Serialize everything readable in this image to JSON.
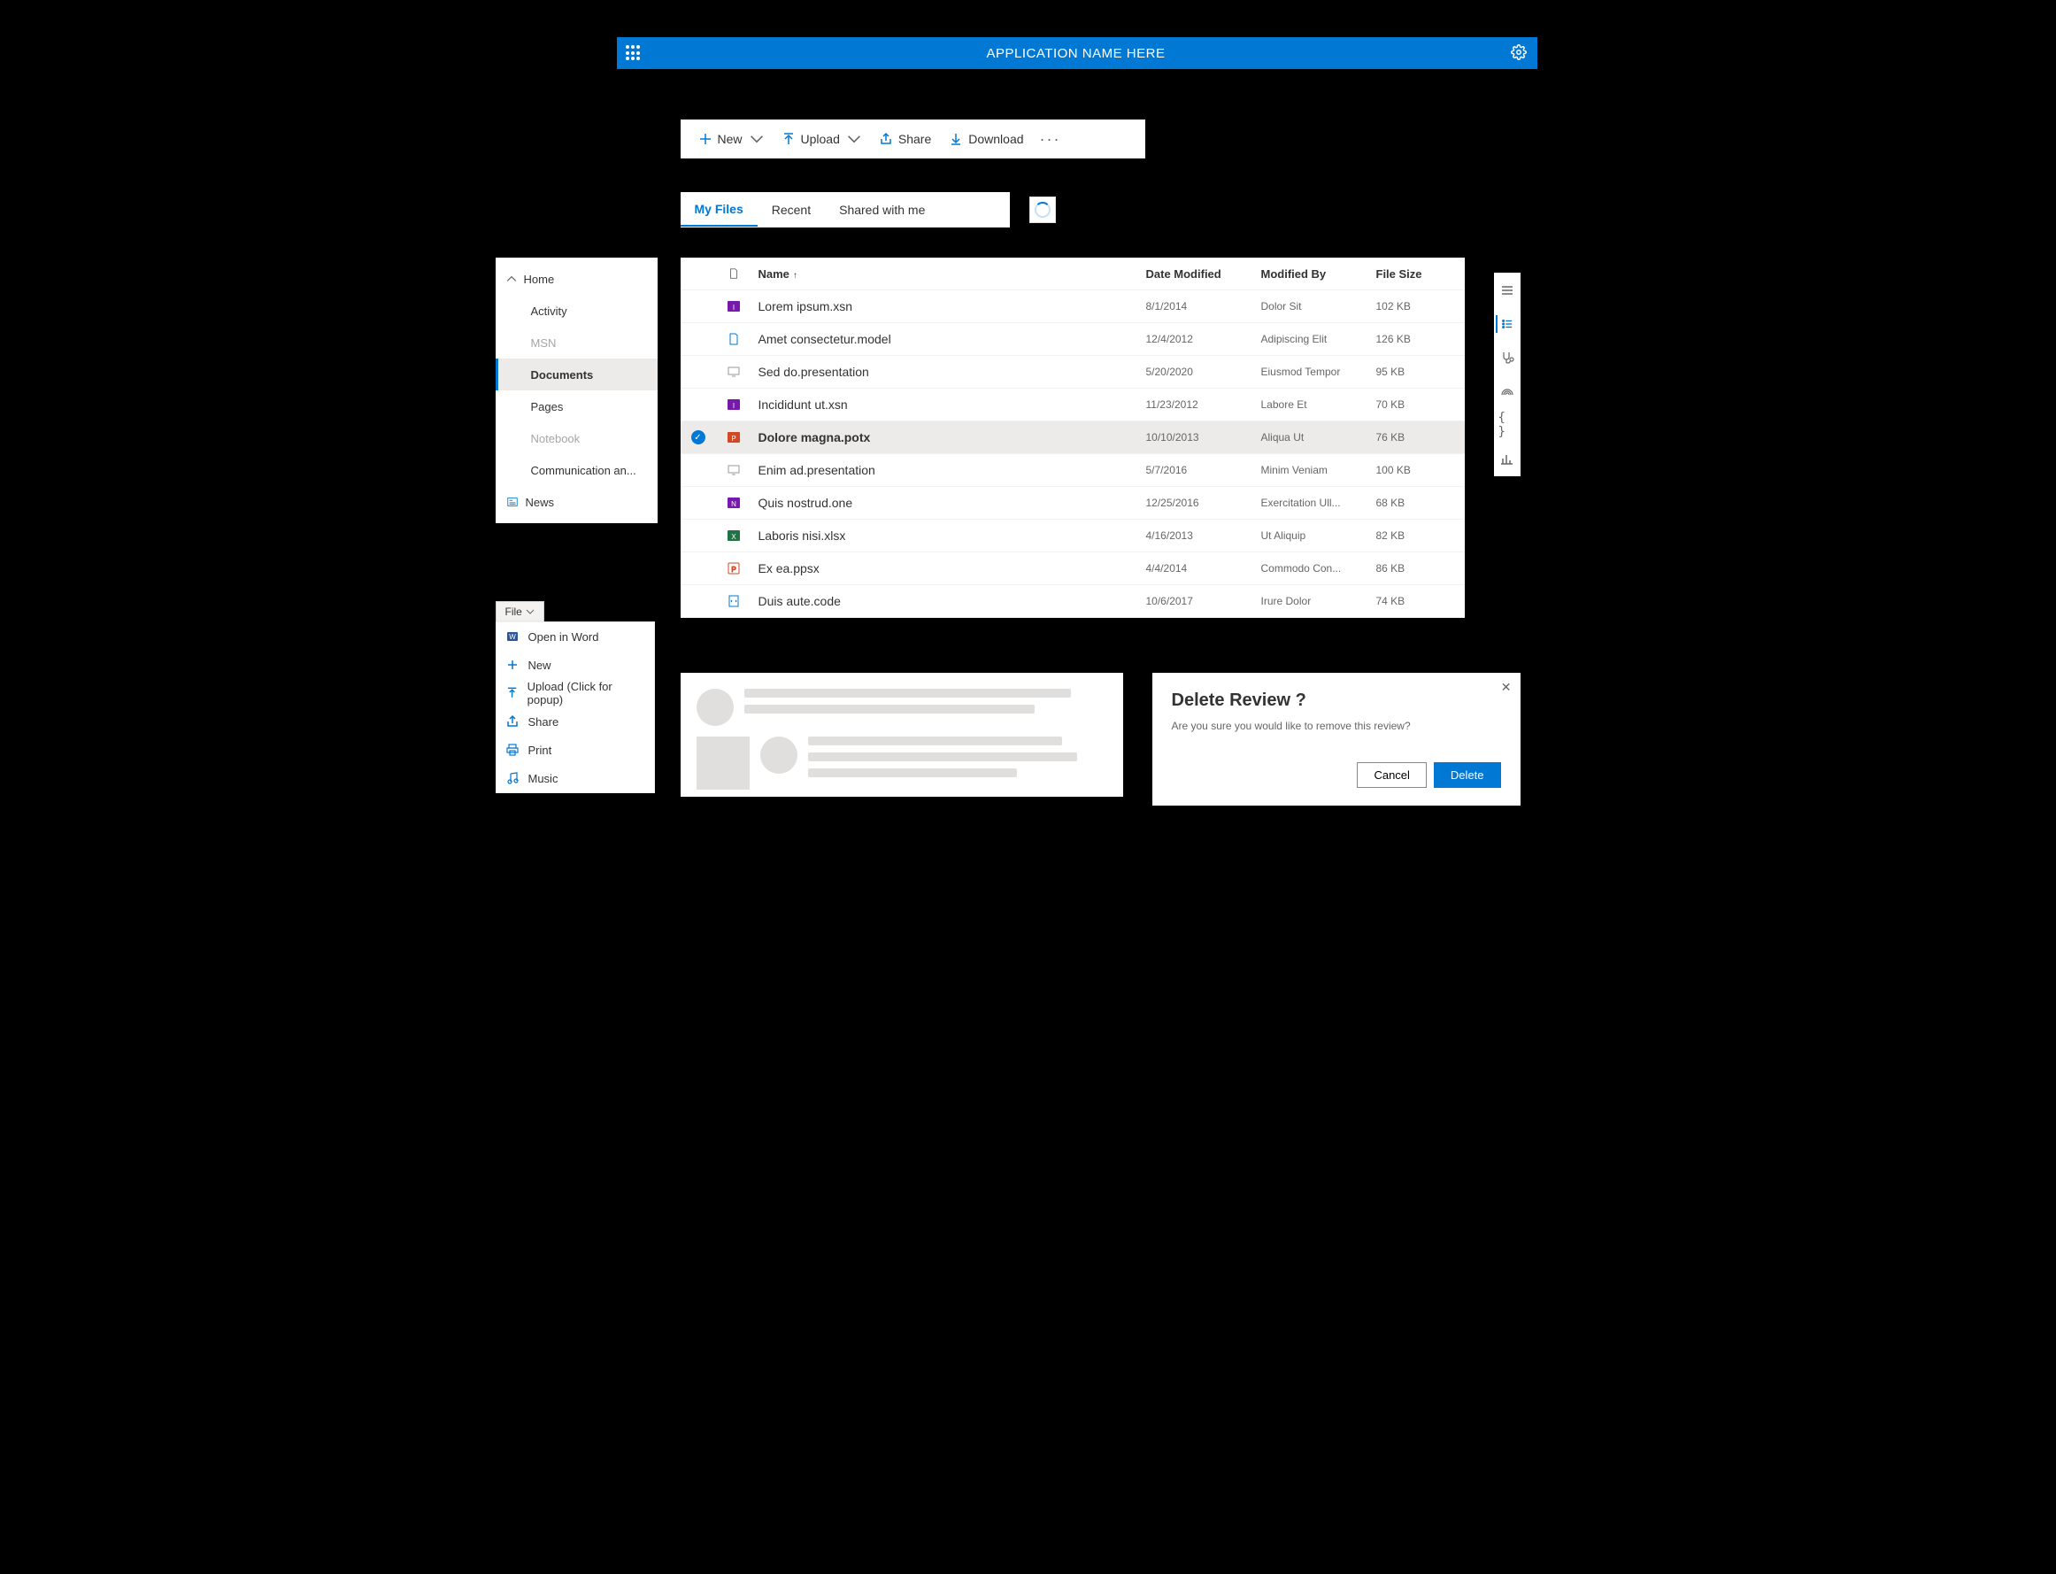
{
  "header": {
    "title": "APPLICATION NAME HERE"
  },
  "commandBar": {
    "new": "New",
    "upload": "Upload",
    "share": "Share",
    "download": "Download"
  },
  "tabs": [
    {
      "label": "My Files",
      "active": true
    },
    {
      "label": "Recent",
      "active": false
    },
    {
      "label": "Shared with me",
      "active": false
    }
  ],
  "nav": {
    "home": "Home",
    "items": [
      {
        "label": "Activity",
        "disabled": false
      },
      {
        "label": "MSN",
        "disabled": true
      },
      {
        "label": "Documents",
        "selected": true
      },
      {
        "label": "Pages",
        "disabled": false
      },
      {
        "label": "Notebook",
        "disabled": true
      },
      {
        "label": "Communication an...",
        "disabled": false
      }
    ],
    "news": "News"
  },
  "table": {
    "columns": {
      "name": "Name",
      "date": "Date Modified",
      "by": "Modified By",
      "size": "File Size"
    },
    "rows": [
      {
        "name": "Lorem ipsum.xsn",
        "date": "8/1/2014",
        "by": "Dolor Sit",
        "size": "102 KB",
        "icon": "infopath"
      },
      {
        "name": "Amet consectetur.model",
        "date": "12/4/2012",
        "by": "Adipiscing Elit",
        "size": "126 KB",
        "icon": "generic"
      },
      {
        "name": "Sed do.presentation",
        "date": "5/20/2020",
        "by": "Eiusmod Tempor",
        "size": "95 KB",
        "icon": "present"
      },
      {
        "name": "Incididunt ut.xsn",
        "date": "11/23/2012",
        "by": "Labore Et",
        "size": "70 KB",
        "icon": "infopath"
      },
      {
        "name": "Dolore magna.potx",
        "date": "10/10/2013",
        "by": "Aliqua Ut",
        "size": "76 KB",
        "icon": "ppt",
        "selected": true
      },
      {
        "name": "Enim ad.presentation",
        "date": "5/7/2016",
        "by": "Minim Veniam",
        "size": "100 KB",
        "icon": "present"
      },
      {
        "name": "Quis nostrud.one",
        "date": "12/25/2016",
        "by": "Exercitation Ull...",
        "size": "68 KB",
        "icon": "onenote"
      },
      {
        "name": "Laboris nisi.xlsx",
        "date": "4/16/2013",
        "by": "Ut Aliquip",
        "size": "82 KB",
        "icon": "excel"
      },
      {
        "name": "Ex ea.ppsx",
        "date": "4/4/2014",
        "by": "Commodo Con...",
        "size": "86 KB",
        "icon": "ppt-outline"
      },
      {
        "name": "Duis aute.code",
        "date": "10/6/2017",
        "by": "Irure Dolor",
        "size": "74 KB",
        "icon": "code"
      }
    ]
  },
  "fileMenu": {
    "tabLabel": "File",
    "items": [
      {
        "label": "Open in Word",
        "icon": "word"
      },
      {
        "label": "New",
        "icon": "plus"
      },
      {
        "label": "Upload (Click for popup)",
        "icon": "upload"
      },
      {
        "label": "Share",
        "icon": "share"
      },
      {
        "label": "Print",
        "icon": "print"
      },
      {
        "label": "Music",
        "icon": "music"
      }
    ]
  },
  "dialog": {
    "title": "Delete Review ?",
    "body": "Are you sure you would like to remove this review?",
    "cancel": "Cancel",
    "confirm": "Delete"
  }
}
